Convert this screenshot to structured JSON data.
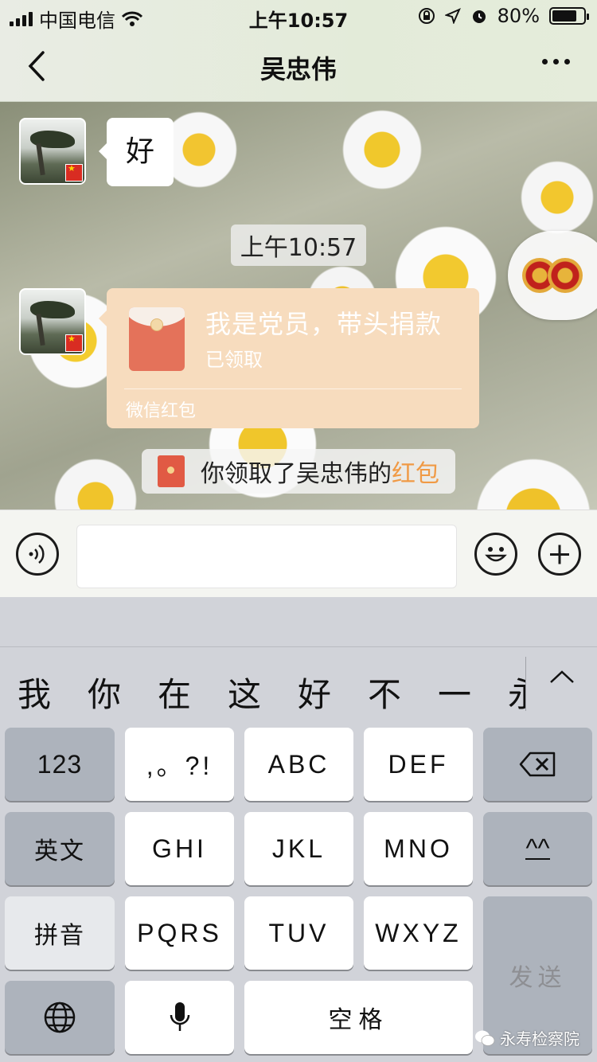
{
  "status_bar": {
    "carrier": "中国电信",
    "time": "上午10:57",
    "battery": "80%",
    "battery_level": 0.8
  },
  "nav": {
    "title": "吴忠伟"
  },
  "chat": {
    "messages": [
      {
        "type": "text",
        "text": "好"
      }
    ],
    "timestamp": "上午10:57",
    "red_packet": {
      "title": "我是党员，带头捐款",
      "status": "已领取",
      "footer": "微信红包"
    },
    "system_message": {
      "prefix": "你领取了吴忠伟的",
      "highlight": "红包",
      "highlight_color": "#f09a45"
    }
  },
  "keyboard": {
    "candidates": [
      "我",
      "你",
      "在",
      "这",
      "好",
      "不",
      "一",
      "永"
    ],
    "rows": [
      [
        "123",
        ",。?!",
        "ABC",
        "DEF"
      ],
      [
        "英文",
        "GHI",
        "JKL",
        "MNO",
        "^^"
      ],
      [
        "拼音",
        "PQRS",
        "TUV",
        "WXYZ",
        "发送"
      ],
      [
        "空格"
      ]
    ]
  },
  "watermark": "永寿检察院",
  "colors": {
    "red_packet_bg": "#f7dcbe",
    "red_packet_icon": "#e4725a"
  }
}
